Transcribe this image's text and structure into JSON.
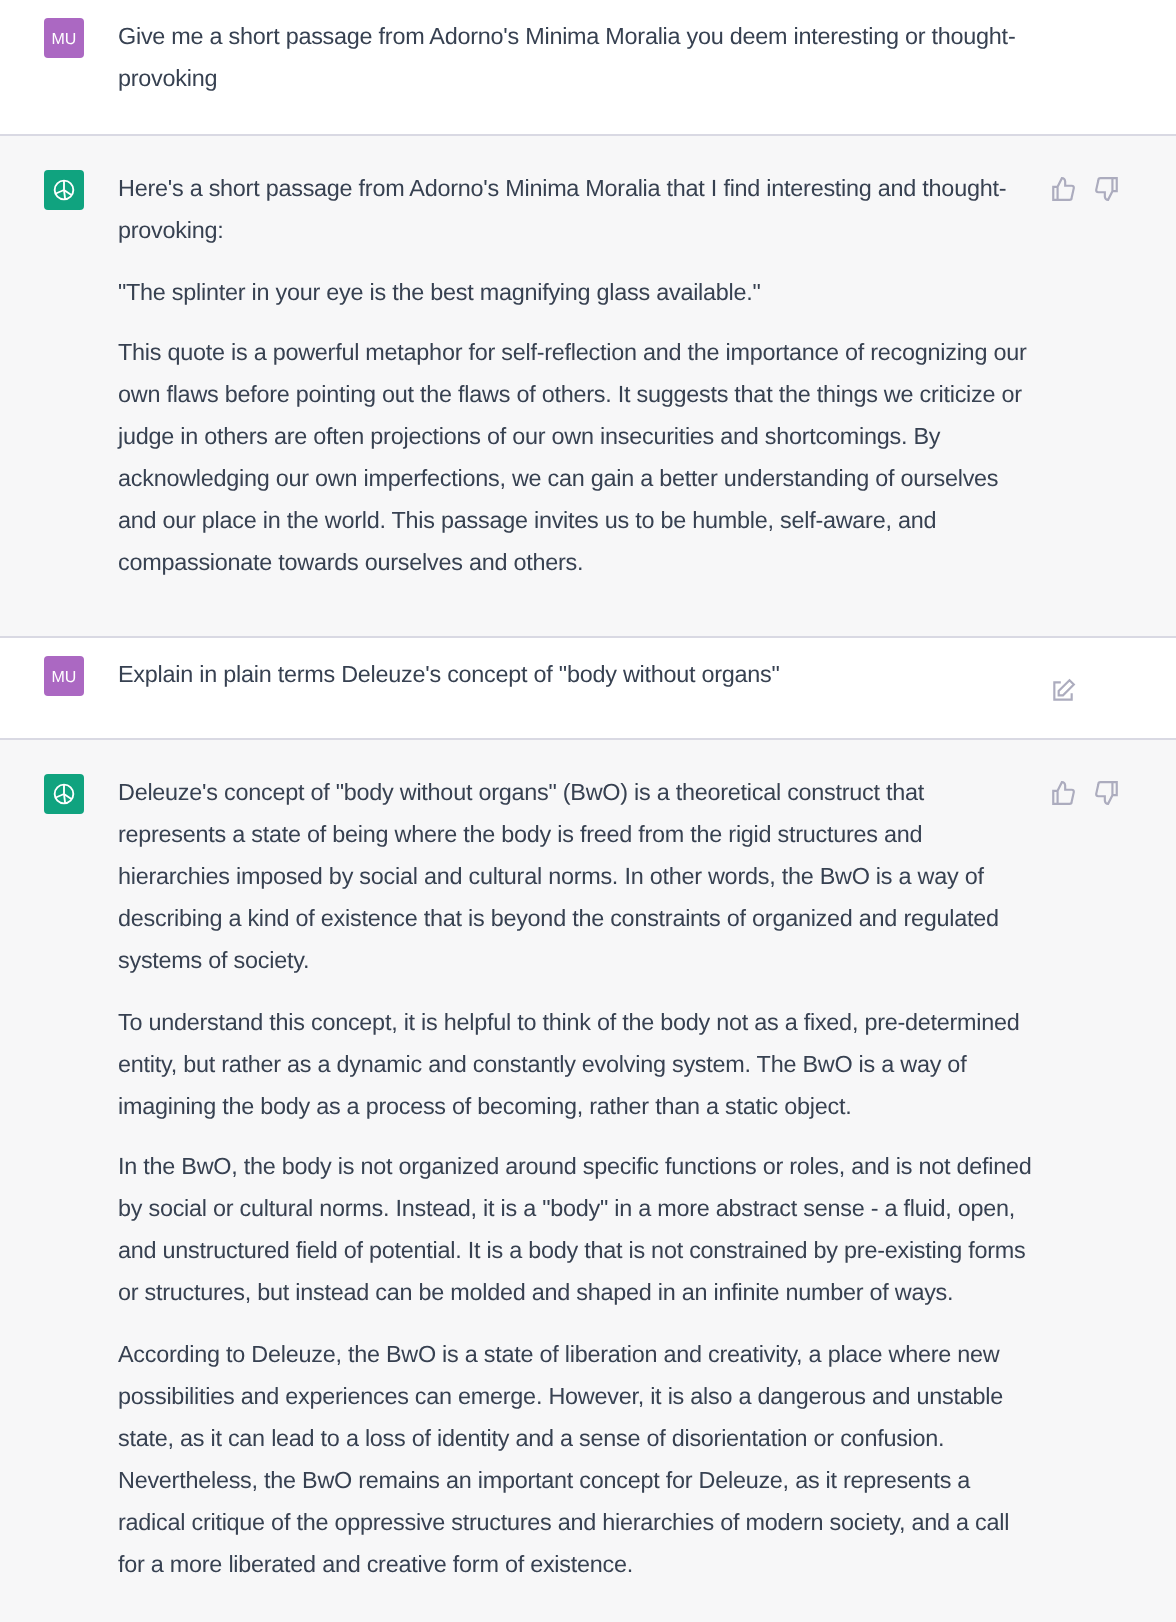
{
  "messages": [
    {
      "kind": "user",
      "avatar": "MU",
      "edit_icon": false,
      "paragraphs": [
        "Give me a short passage from Adorno's Minima Moralia you deem interesting or thought-provoking"
      ]
    },
    {
      "kind": "assistant",
      "paragraphs": [
        "Here's a short passage from Adorno's Minima Moralia that I find interesting and thought-provoking:",
        "\"The splinter in your eye is the best magnifying glass available.\"",
        "This quote is a powerful metaphor for self-reflection and the importance of recognizing our own flaws before pointing out the flaws of others. It suggests that the things we criticize or judge in others are often projections of our own insecurities and shortcomings. By acknowledging our own imperfections, we can gain a better understanding of ourselves and our place in the world. This passage invites us to be humble, self-aware, and compassionate towards ourselves and others."
      ]
    },
    {
      "kind": "user",
      "avatar": "MU",
      "edit_icon": true,
      "paragraphs": [
        "Explain in plain terms Deleuze's concept of \"body without organs\""
      ]
    },
    {
      "kind": "assistant",
      "paragraphs": [
        "Deleuze's concept of \"body without organs\" (BwO) is a theoretical construct that represents a state of being where the body is freed from the rigid structures and hierarchies imposed by social and cultural norms. In other words, the BwO is a way of describing a kind of existence that is beyond the constraints of organized and regulated systems of society.",
        "To understand this concept, it is helpful to think of the body not as a fixed, pre-determined entity, but rather as a dynamic and constantly evolving system. The BwO is a way of imagining the body as a process of becoming, rather than a static object.",
        "In the BwO, the body is not organized around specific functions or roles, and is not defined by social or cultural norms. Instead, it is a \"body\" in a more abstract sense - a fluid, open, and unstructured field of potential. It is a body that is not constrained by pre-existing forms or structures, but instead can be molded and shaped in an infinite number of ways.",
        "According to Deleuze, the BwO is a state of liberation and creativity, a place where new possibilities and experiences can emerge. However, it is also a dangerous and unstable state, as it can lead to a loss of identity and a sense of disorientation or confusion. Nevertheless, the BwO remains an important concept for Deleuze, as it represents a radical critique of the oppressive structures and hierarchies of modern society, and a call for a more liberated and creative form of existence."
      ]
    }
  ]
}
